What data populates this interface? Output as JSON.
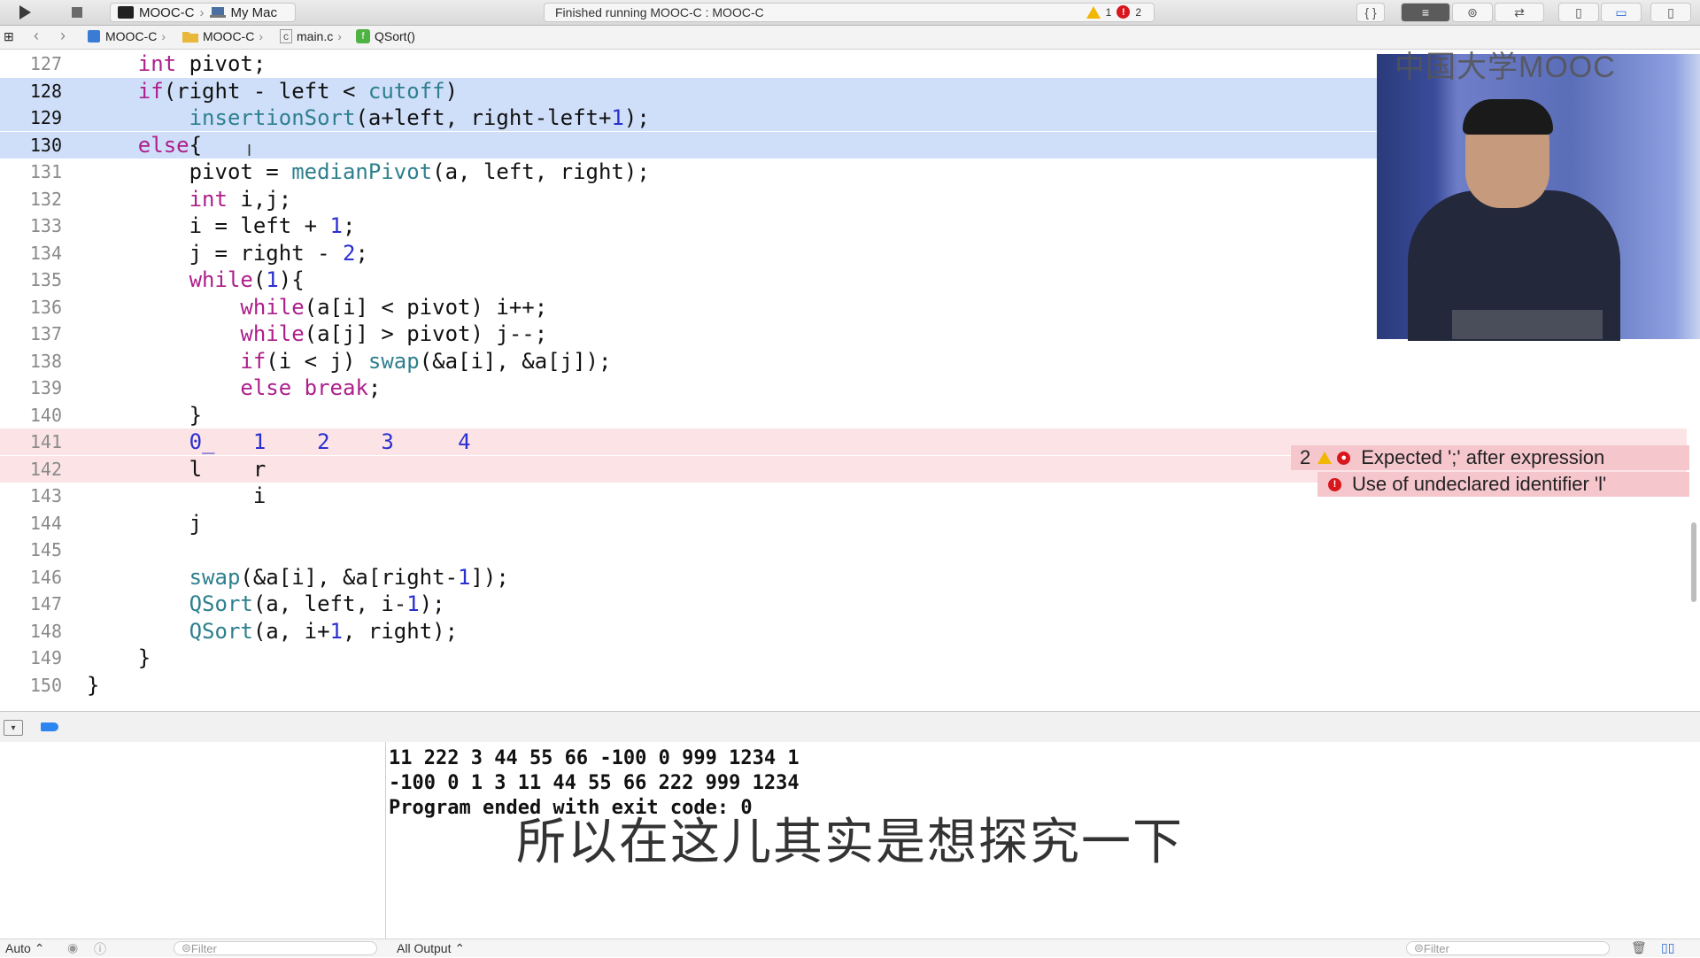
{
  "toolbar": {
    "scheme_project": "MOOC-C",
    "scheme_device": "My Mac",
    "status_text": "Finished running MOOC-C : MOOC-C",
    "warnings_count": "1",
    "errors_count": "2"
  },
  "jumpbar": {
    "project": "MOOC-C",
    "folder": "MOOC-C",
    "file": "main.c",
    "symbol": "QSort()"
  },
  "editor": {
    "lines": [
      {
        "num": "127",
        "tokens": [
          {
            "t": "    "
          },
          {
            "t": "int",
            "c": "kw"
          },
          {
            "t": " pivot;"
          }
        ]
      },
      {
        "num": "128",
        "tokens": [
          {
            "t": "    "
          },
          {
            "t": "if",
            "c": "kw"
          },
          {
            "t": "(right - left < "
          },
          {
            "t": "cutoff",
            "c": "fn"
          },
          {
            "t": ")"
          }
        ]
      },
      {
        "num": "129",
        "tokens": [
          {
            "t": "        "
          },
          {
            "t": "insertionSort",
            "c": "fn"
          },
          {
            "t": "(a+left, right-left+"
          },
          {
            "t": "1",
            "c": "num"
          },
          {
            "t": ");"
          }
        ]
      },
      {
        "num": "130",
        "tokens": [
          {
            "t": "    "
          },
          {
            "t": "else",
            "c": "kw"
          },
          {
            "t": "{"
          }
        ]
      },
      {
        "num": "131",
        "tokens": [
          {
            "t": "        pivot = "
          },
          {
            "t": "medianPivot",
            "c": "fn"
          },
          {
            "t": "(a, left, right);"
          }
        ]
      },
      {
        "num": "132",
        "tokens": [
          {
            "t": "        "
          },
          {
            "t": "int",
            "c": "kw"
          },
          {
            "t": " i,j;"
          }
        ]
      },
      {
        "num": "133",
        "tokens": [
          {
            "t": "        i = left + "
          },
          {
            "t": "1",
            "c": "num"
          },
          {
            "t": ";"
          }
        ]
      },
      {
        "num": "134",
        "tokens": [
          {
            "t": "        j = right - "
          },
          {
            "t": "2",
            "c": "num"
          },
          {
            "t": ";"
          }
        ]
      },
      {
        "num": "135",
        "tokens": [
          {
            "t": "        "
          },
          {
            "t": "while",
            "c": "kw"
          },
          {
            "t": "("
          },
          {
            "t": "1",
            "c": "num"
          },
          {
            "t": "){"
          }
        ]
      },
      {
        "num": "136",
        "tokens": [
          {
            "t": "            "
          },
          {
            "t": "while",
            "c": "kw"
          },
          {
            "t": "(a[i] < pivot) i++;"
          }
        ]
      },
      {
        "num": "137",
        "tokens": [
          {
            "t": "            "
          },
          {
            "t": "while",
            "c": "kw"
          },
          {
            "t": "(a[j] > pivot) j--;"
          }
        ]
      },
      {
        "num": "138",
        "tokens": [
          {
            "t": "            "
          },
          {
            "t": "if",
            "c": "kw"
          },
          {
            "t": "(i < j) "
          },
          {
            "t": "swap",
            "c": "fn"
          },
          {
            "t": "(&a[i], &a[j]);"
          }
        ]
      },
      {
        "num": "139",
        "tokens": [
          {
            "t": "            "
          },
          {
            "t": "else",
            "c": "kw"
          },
          {
            "t": " "
          },
          {
            "t": "break",
            "c": "kw"
          },
          {
            "t": ";"
          }
        ]
      },
      {
        "num": "140",
        "tokens": [
          {
            "t": "        }"
          }
        ]
      },
      {
        "num": "141",
        "tokens": [
          {
            "t": "        "
          },
          {
            "t": "0_",
            "c": "num"
          },
          {
            "t": "   "
          },
          {
            "t": "1",
            "c": "num"
          },
          {
            "t": "    "
          },
          {
            "t": "2",
            "c": "num"
          },
          {
            "t": "    "
          },
          {
            "t": "3",
            "c": "num"
          },
          {
            "t": "     "
          },
          {
            "t": "4",
            "c": "num"
          }
        ]
      },
      {
        "num": "142",
        "tokens": [
          {
            "t": "        l    r"
          }
        ]
      },
      {
        "num": "143",
        "tokens": [
          {
            "t": "             i"
          }
        ]
      },
      {
        "num": "144",
        "tokens": [
          {
            "t": "        j"
          }
        ]
      },
      {
        "num": "145",
        "tokens": [
          {
            "t": ""
          }
        ]
      },
      {
        "num": "146",
        "tokens": [
          {
            "t": "        "
          },
          {
            "t": "swap",
            "c": "fn"
          },
          {
            "t": "(&a[i], &a[right-"
          },
          {
            "t": "1",
            "c": "num"
          },
          {
            "t": "]);"
          }
        ]
      },
      {
        "num": "147",
        "tokens": [
          {
            "t": "        "
          },
          {
            "t": "QSort",
            "c": "fn"
          },
          {
            "t": "(a, left, i-"
          },
          {
            "t": "1",
            "c": "num"
          },
          {
            "t": ");"
          }
        ]
      },
      {
        "num": "148",
        "tokens": [
          {
            "t": "        "
          },
          {
            "t": "QSort",
            "c": "fn"
          },
          {
            "t": "(a, i+"
          },
          {
            "t": "1",
            "c": "num"
          },
          {
            "t": ", right);"
          }
        ]
      },
      {
        "num": "149",
        "tokens": [
          {
            "t": "    }"
          }
        ]
      },
      {
        "num": "150",
        "tokens": [
          {
            "t": "}"
          }
        ]
      }
    ],
    "selected_lines": [
      "128",
      "129",
      "130"
    ],
    "error_lines": [
      "141",
      "142"
    ]
  },
  "issues": [
    {
      "count": "2",
      "message": "Expected ';' after expression"
    },
    {
      "message": "Use of undeclared identifier 'l'"
    }
  ],
  "video": {
    "watermark": "中国大学MOOC"
  },
  "console": {
    "lines": [
      "11 222 3 44 55 66 -100 0 999 1234 1",
      "-100 0 1 3 11 44 55 66 222 999 1234",
      "Program ended with exit code: 0"
    ]
  },
  "subtitle": "所以在这儿其实是想探究一下",
  "bottombar": {
    "auto_label": "Auto",
    "filter_left": "Filter",
    "output_select": "All Output",
    "filter_right": "Filter"
  },
  "colors": {
    "selection": "#cfdff9",
    "error_line": "#fbe3e6",
    "keyword": "#ad1f8b",
    "function": "#2e7f8e",
    "number": "#2a2fd0"
  }
}
